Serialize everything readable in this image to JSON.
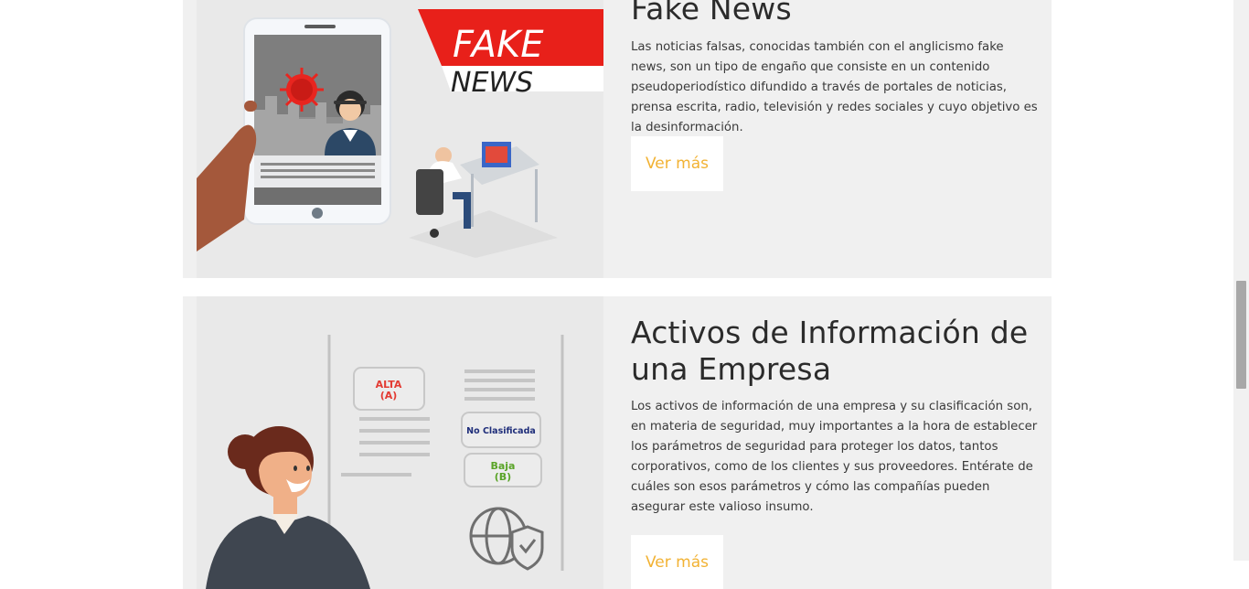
{
  "cards": [
    {
      "title": "Fake News",
      "description": "Las noticias falsas, conocidas también con el anglicismo fake news, son un tipo de engaño que consiste en un contenido pseudoperiodístico difundido a través de portales de noticias, prensa escrita, radio, televisión y redes sociales y cuyo objetivo es la desinformación.",
      "button_label": "Ver más",
      "banner_line1": "FAKE",
      "banner_line2": "NEWS"
    },
    {
      "title": "Activos de Información de una Empresa",
      "description": "Los activos de información de una empresa y su clasificación son, en materia de seguridad, muy importantes a la hora de establecer los parámetros de seguridad para proteger los datos, tantos corporativos, como de los clientes y sus proveedores. Entérate de cuáles son esos parámetros y cómo las compañías pueden asegurar este valioso insumo.",
      "button_label": "Ver más",
      "tag_alta": "ALTA",
      "tag_alta_code": "(A)",
      "tag_no_clasificada": "No Clasificada",
      "tag_baja": "Baja",
      "tag_baja_code": "(B)"
    }
  ],
  "colors": {
    "button_text": "#f2b233",
    "card_bg": "#f0f0f0",
    "banner_red": "#e8201a"
  }
}
